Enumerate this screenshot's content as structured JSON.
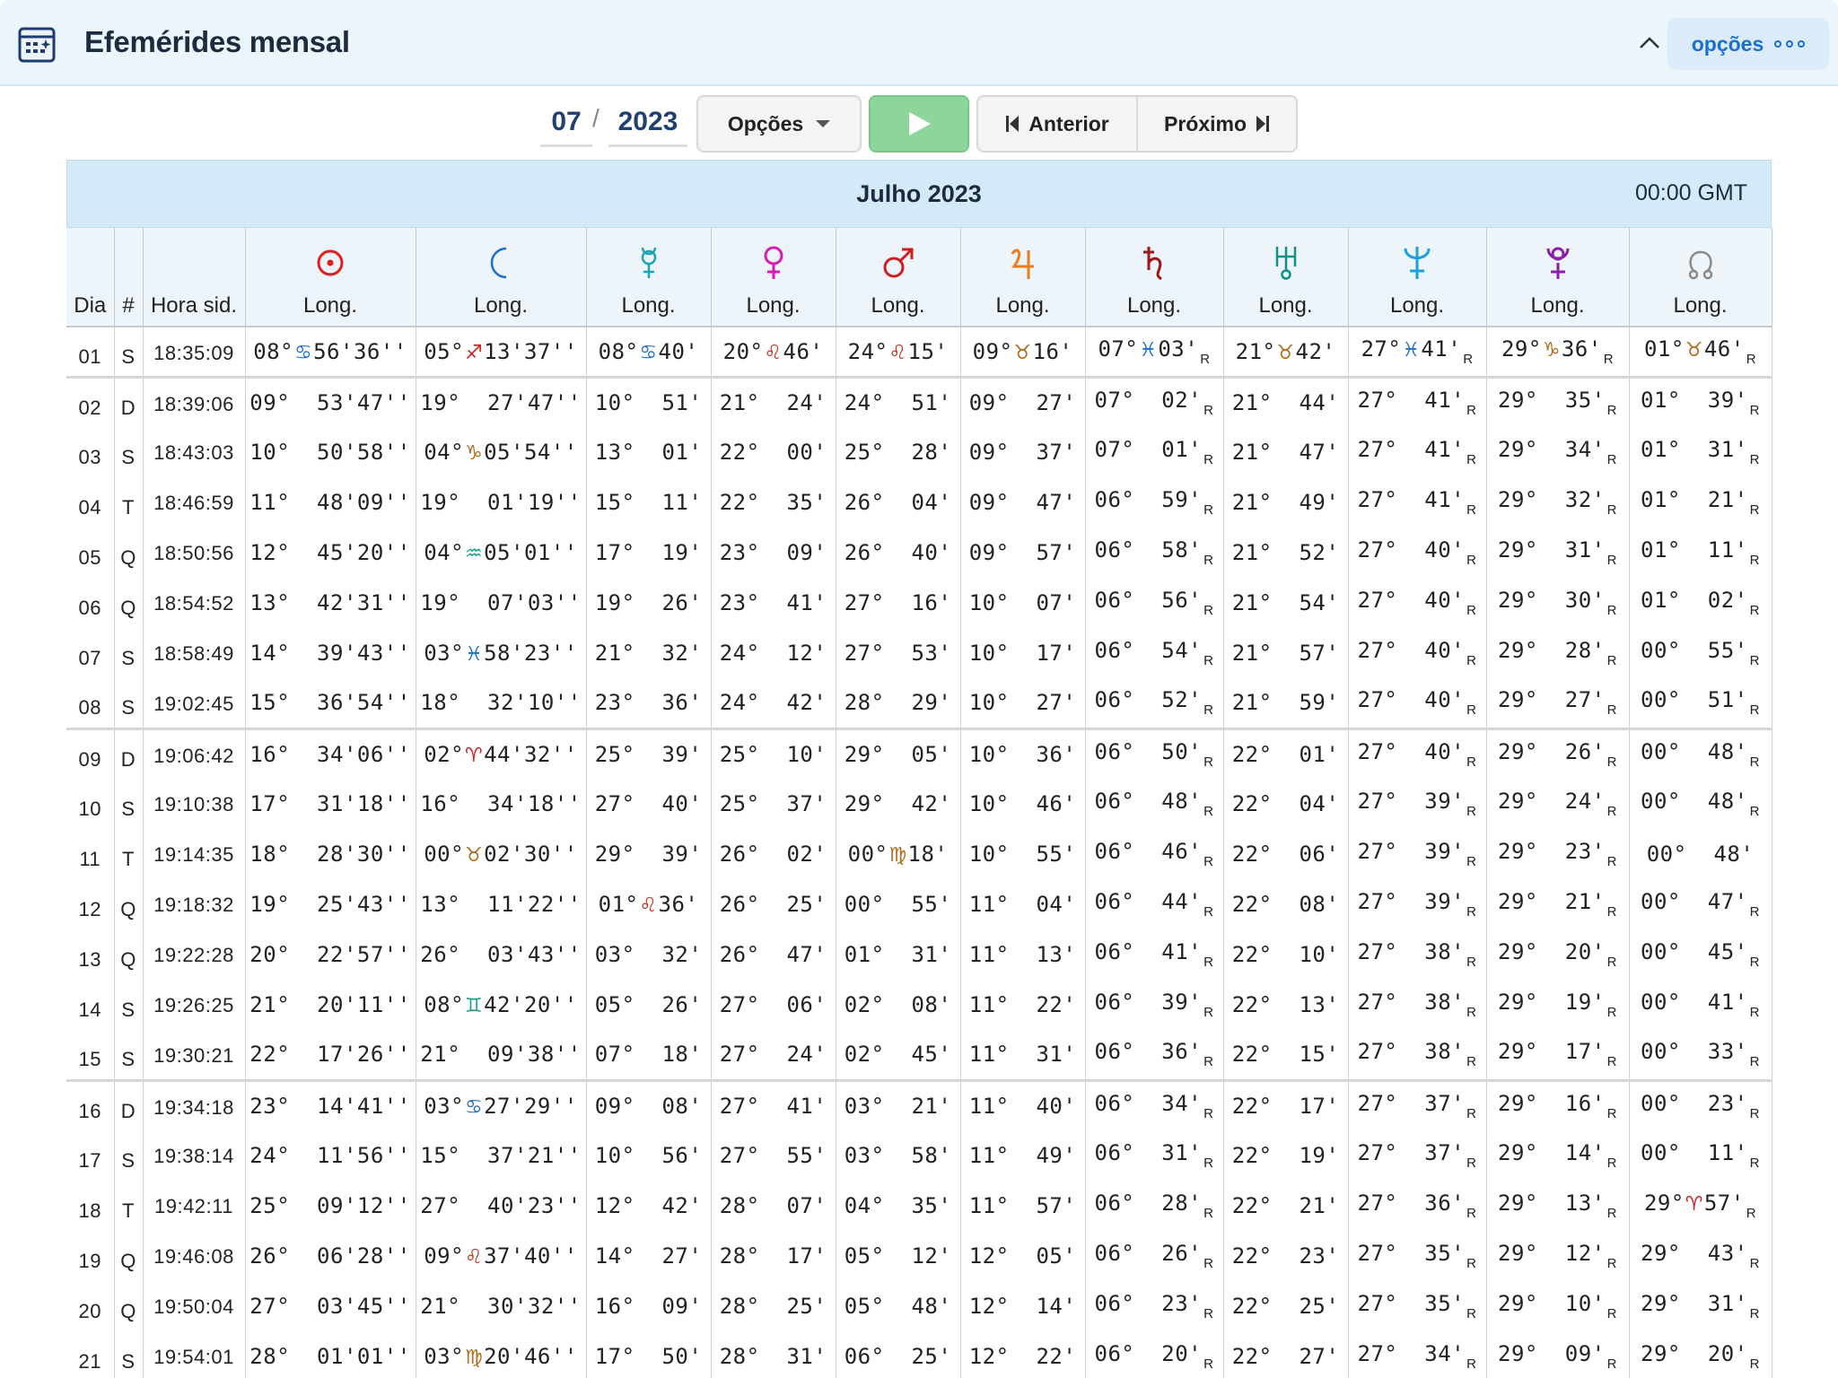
{
  "header": {
    "title": "Efemérides mensal",
    "options_label": "opções"
  },
  "controls": {
    "month": "07",
    "slash": "/",
    "year": "2023",
    "options_label": "Opções",
    "prev_label": "Anterior",
    "next_label": "Próximo"
  },
  "table": {
    "month_title": "Julho 2023",
    "time_label": "00:00 GMT",
    "headers": {
      "day": "Dia",
      "dow": "#",
      "sid": "Hora sid.",
      "planets": [
        {
          "name": "sun-symbol",
          "label": "Long.",
          "color": "#e11d1d"
        },
        {
          "name": "moon-symbol",
          "label": "Long.",
          "color": "#1f6fd1"
        },
        {
          "name": "mercury-symbol",
          "label": "Long.",
          "color": "#19a4b8"
        },
        {
          "name": "venus-symbol",
          "label": "Long.",
          "color": "#d81bb2"
        },
        {
          "name": "mars-symbol",
          "label": "Long.",
          "color": "#d11d1d"
        },
        {
          "name": "jupiter-symbol",
          "label": "Long.",
          "color": "#f07a1a"
        },
        {
          "name": "saturn-symbol",
          "label": "Long.",
          "color": "#a01616"
        },
        {
          "name": "uranus-symbol",
          "label": "Long.",
          "color": "#0f8f8a"
        },
        {
          "name": "neptune-symbol",
          "label": "Long.",
          "color": "#1aa0e0"
        },
        {
          "name": "pluto-symbol",
          "label": "Long.",
          "color": "#8a1fa8"
        },
        {
          "name": "node-symbol",
          "label": "Long.",
          "color": "#8a8a8a"
        }
      ]
    },
    "rows": [
      {
        "day": "01",
        "dow": "S",
        "sid": "18:35:09",
        "cells": [
          "08°|cancer|56'36''",
          "05°|sagittarius|13'37''",
          "08°|cancer|40'",
          "20°|leo|46'",
          "24°|leo|15'",
          "09°|taurus|16'",
          "07°|pisces|03'|R",
          "21°|taurus|42'",
          "27°|pisces|41'|R",
          "29°|capricorn|36'|R",
          "01°|taurus|46'|R"
        ]
      },
      {
        "day": "02",
        "dow": "D",
        "sid": "18:39:06",
        "cells": [
          "09°  53'47''",
          "19°  27'47''",
          "10°  51'",
          "21°  24'",
          "24°  51'",
          "09°  27'",
          "07°  02'|R",
          "21°  44'",
          "27°  41'|R",
          "29°  35'|R",
          "01°  39'|R"
        ]
      },
      {
        "day": "03",
        "dow": "S",
        "sid": "18:43:03",
        "cells": [
          "10°  50'58''",
          "04°|capricorn|05'54''",
          "13°  01'",
          "22°  00'",
          "25°  28'",
          "09°  37'",
          "07°  01'|R",
          "21°  47'",
          "27°  41'|R",
          "29°  34'|R",
          "01°  31'|R"
        ]
      },
      {
        "day": "04",
        "dow": "T",
        "sid": "18:46:59",
        "cells": [
          "11°  48'09''",
          "19°  01'19''",
          "15°  11'",
          "22°  35'",
          "26°  04'",
          "09°  47'",
          "06°  59'|R",
          "21°  49'",
          "27°  41'|R",
          "29°  32'|R",
          "01°  21'|R"
        ]
      },
      {
        "day": "05",
        "dow": "Q",
        "sid": "18:50:56",
        "cells": [
          "12°  45'20''",
          "04°|aquarius|05'01''",
          "17°  19'",
          "23°  09'",
          "26°  40'",
          "09°  57'",
          "06°  58'|R",
          "21°  52'",
          "27°  40'|R",
          "29°  31'|R",
          "01°  11'|R"
        ]
      },
      {
        "day": "06",
        "dow": "Q",
        "sid": "18:54:52",
        "cells": [
          "13°  42'31''",
          "19°  07'03''",
          "19°  26'",
          "23°  41'",
          "27°  16'",
          "10°  07'",
          "06°  56'|R",
          "21°  54'",
          "27°  40'|R",
          "29°  30'|R",
          "01°  02'|R"
        ]
      },
      {
        "day": "07",
        "dow": "S",
        "sid": "18:58:49",
        "cells": [
          "14°  39'43''",
          "03°|pisces|58'23''",
          "21°  32'",
          "24°  12'",
          "27°  53'",
          "10°  17'",
          "06°  54'|R",
          "21°  57'",
          "27°  40'|R",
          "29°  28'|R",
          "00°  55'|R"
        ]
      },
      {
        "day": "08",
        "dow": "S",
        "sid": "19:02:45",
        "cells": [
          "15°  36'54''",
          "18°  32'10''",
          "23°  36'",
          "24°  42'",
          "28°  29'",
          "10°  27'",
          "06°  52'|R",
          "21°  59'",
          "27°  40'|R",
          "29°  27'|R",
          "00°  51'|R"
        ]
      },
      {
        "day": "09",
        "dow": "D",
        "sid": "19:06:42",
        "cells": [
          "16°  34'06''",
          "02°|aries|44'32''",
          "25°  39'",
          "25°  10'",
          "29°  05'",
          "10°  36'",
          "06°  50'|R",
          "22°  01'",
          "27°  40'|R",
          "29°  26'|R",
          "00°  48'|R"
        ]
      },
      {
        "day": "10",
        "dow": "S",
        "sid": "19:10:38",
        "cells": [
          "17°  31'18''",
          "16°  34'18''",
          "27°  40'",
          "25°  37'",
          "29°  42'",
          "10°  46'",
          "06°  48'|R",
          "22°  04'",
          "27°  39'|R",
          "29°  24'|R",
          "00°  48'|R"
        ]
      },
      {
        "day": "11",
        "dow": "T",
        "sid": "19:14:35",
        "cells": [
          "18°  28'30''",
          "00°|taurus|02'30''",
          "29°  39'",
          "26°  02'",
          "00°|virgo|18'",
          "10°  55'",
          "06°  46'|R",
          "22°  06'",
          "27°  39'|R",
          "29°  23'|R",
          "00°  48'"
        ]
      },
      {
        "day": "12",
        "dow": "Q",
        "sid": "19:18:32",
        "cells": [
          "19°  25'43''",
          "13°  11'22''",
          "01°|leo|36'",
          "26°  25'",
          "00°  55'",
          "11°  04'",
          "06°  44'|R",
          "22°  08'",
          "27°  39'|R",
          "29°  21'|R",
          "00°  47'|R"
        ]
      },
      {
        "day": "13",
        "dow": "Q",
        "sid": "19:22:28",
        "cells": [
          "20°  22'57''",
          "26°  03'43''",
          "03°  32'",
          "26°  47'",
          "01°  31'",
          "11°  13'",
          "06°  41'|R",
          "22°  10'",
          "27°  38'|R",
          "29°  20'|R",
          "00°  45'|R"
        ]
      },
      {
        "day": "14",
        "dow": "S",
        "sid": "19:26:25",
        "cells": [
          "21°  20'11''",
          "08°|gemini|42'20''",
          "05°  26'",
          "27°  06'",
          "02°  08'",
          "11°  22'",
          "06°  39'|R",
          "22°  13'",
          "27°  38'|R",
          "29°  19'|R",
          "00°  41'|R"
        ]
      },
      {
        "day": "15",
        "dow": "S",
        "sid": "19:30:21",
        "cells": [
          "22°  17'26''",
          "21°  09'38''",
          "07°  18'",
          "27°  24'",
          "02°  45'",
          "11°  31'",
          "06°  36'|R",
          "22°  15'",
          "27°  38'|R",
          "29°  17'|R",
          "00°  33'|R"
        ]
      },
      {
        "day": "16",
        "dow": "D",
        "sid": "19:34:18",
        "cells": [
          "23°  14'41''",
          "03°|cancer|27'29''",
          "09°  08'",
          "27°  41'",
          "03°  21'",
          "11°  40'",
          "06°  34'|R",
          "22°  17'",
          "27°  37'|R",
          "29°  16'|R",
          "00°  23'|R"
        ]
      },
      {
        "day": "17",
        "dow": "S",
        "sid": "19:38:14",
        "cells": [
          "24°  11'56''",
          "15°  37'21''",
          "10°  56'",
          "27°  55'",
          "03°  58'",
          "11°  49'",
          "06°  31'|R",
          "22°  19'",
          "27°  37'|R",
          "29°  14'|R",
          "00°  11'|R"
        ]
      },
      {
        "day": "18",
        "dow": "T",
        "sid": "19:42:11",
        "cells": [
          "25°  09'12''",
          "27°  40'23''",
          "12°  42'",
          "28°  07'",
          "04°  35'",
          "11°  57'",
          "06°  28'|R",
          "22°  21'",
          "27°  36'|R",
          "29°  13'|R",
          "29°|aries|57'|R"
        ]
      },
      {
        "day": "19",
        "dow": "Q",
        "sid": "19:46:08",
        "cells": [
          "26°  06'28''",
          "09°|leo|37'40''",
          "14°  27'",
          "28°  17'",
          "05°  12'",
          "12°  05'",
          "06°  26'|R",
          "22°  23'",
          "27°  35'|R",
          "29°  12'|R",
          "29°  43'|R"
        ]
      },
      {
        "day": "20",
        "dow": "Q",
        "sid": "19:50:04",
        "cells": [
          "27°  03'45''",
          "21°  30'32''",
          "16°  09'",
          "28°  25'",
          "05°  48'",
          "12°  14'",
          "06°  23'|R",
          "22°  25'",
          "27°  35'|R",
          "29°  10'|R",
          "29°  31'|R"
        ]
      },
      {
        "day": "21",
        "dow": "S",
        "sid": "19:54:01",
        "cells": [
          "28°  01'01''",
          "03°|virgo|20'46''",
          "17°  50'",
          "28°  31'",
          "06°  25'",
          "12°  22'",
          "06°  20'|R",
          "22°  27'",
          "27°  34'|R",
          "29°  09'|R",
          "29°  20'|R"
        ]
      }
    ],
    "sign_glyphs": {
      "aries": {
        "glyph": "♈",
        "color": "#d11d1d"
      },
      "taurus": {
        "glyph": "♉",
        "color": "#b36a1a"
      },
      "gemini": {
        "glyph": "♊",
        "color": "#1aa08f"
      },
      "cancer": {
        "glyph": "♋",
        "color": "#1f6fd1"
      },
      "leo": {
        "glyph": "♌",
        "color": "#c0301a"
      },
      "virgo": {
        "glyph": "♍",
        "color": "#b36a1a"
      },
      "sagittarius": {
        "glyph": "♐",
        "color": "#d11d1d"
      },
      "capricorn": {
        "glyph": "♑",
        "color": "#b36a1a"
      },
      "aquarius": {
        "glyph": "♒",
        "color": "#1aa08f"
      },
      "pisces": {
        "glyph": "♓",
        "color": "#1f6fd1"
      }
    }
  }
}
